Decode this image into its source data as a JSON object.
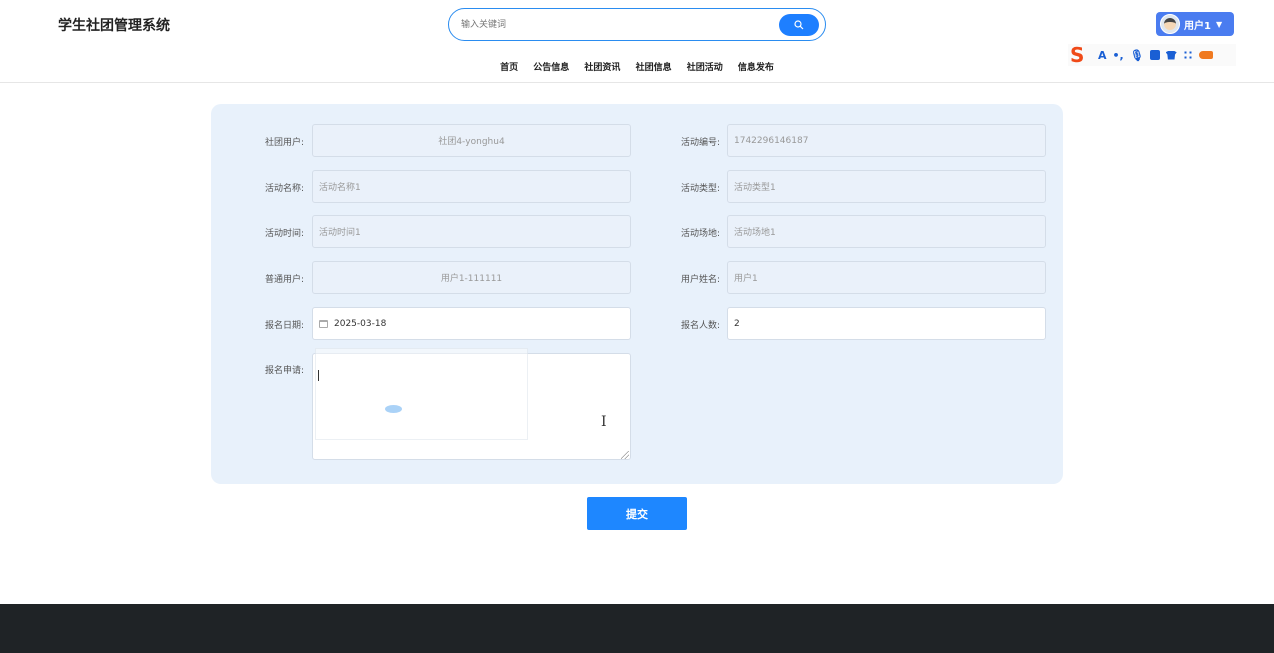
{
  "header": {
    "brand": "学生社团管理系统",
    "search_placeholder": "输入关键词",
    "nav": [
      "首页",
      "公告信息",
      "社团资讯",
      "社团信息",
      "社团活动",
      "信息发布"
    ],
    "user_label": "用户1"
  },
  "form": {
    "left": [
      {
        "label": "社团用户:",
        "value": "社团4-yonghu4"
      },
      {
        "label": "活动名称:",
        "value": "活动名称1"
      },
      {
        "label": "活动时间:",
        "value": "活动时间1"
      },
      {
        "label": "普通用户:",
        "value": "用户1-111111"
      },
      {
        "label": "报名日期:",
        "value": "2025-03-18"
      },
      {
        "label": "报名申请:",
        "value": ""
      }
    ],
    "right": [
      {
        "label": "活动编号:",
        "value": "1742296146187"
      },
      {
        "label": "活动类型:",
        "value": "活动类型1"
      },
      {
        "label": "活动场地:",
        "value": "活动场地1"
      },
      {
        "label": "用户姓名:",
        "value": "用户1"
      },
      {
        "label": "报名人数:",
        "value": "2"
      }
    ]
  },
  "submit_label": "提交",
  "colors": {
    "primary": "#1e87ff",
    "panel": "#e8f1fb",
    "footer": "#1f2326",
    "user_button": "#4a7cf0"
  }
}
